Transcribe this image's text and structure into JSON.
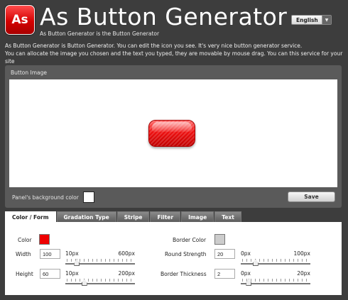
{
  "header": {
    "logo_text": "As",
    "title": "As Button Generator",
    "subtitle": "As Button Generator is the Button Generator",
    "language": {
      "selected": "English"
    }
  },
  "intro": {
    "line1": "As Button Generator is Button Generator. You can edit the icon you see. It's very nice button generator service.",
    "line2": "You can allocate the image you chosen and the text you typed, they are movable by mouse drag. You can this service for your site"
  },
  "image_panel": {
    "label": "Button Image",
    "bg_color_label": "Panel's background color",
    "bg_color": "#ffffff",
    "save_label": "Save"
  },
  "tabs": [
    {
      "label": "Color / Form",
      "active": true
    },
    {
      "label": "Gradation Type",
      "active": false
    },
    {
      "label": "Stripe",
      "active": false
    },
    {
      "label": "Filter",
      "active": false
    },
    {
      "label": "Image",
      "active": false
    },
    {
      "label": "Text",
      "active": false
    }
  ],
  "form": {
    "color": {
      "label": "Color",
      "value": "#ee0000"
    },
    "border_color": {
      "label": "Border Color",
      "value": "#cccccc"
    },
    "width": {
      "label": "Width",
      "value": "100",
      "min_label": "10px",
      "max_label": "600px",
      "min": 10,
      "max": 600
    },
    "height": {
      "label": "Height",
      "value": "60",
      "min_label": "10px",
      "max_label": "200px",
      "min": 10,
      "max": 200
    },
    "round_strength": {
      "label": "Round Strength",
      "value": "20",
      "min_label": "0px",
      "max_label": "100px",
      "min": 0,
      "max": 100
    },
    "border_thickness": {
      "label": "Border Thickness",
      "value": "2",
      "min_label": "0px",
      "max_label": "20px",
      "min": 0,
      "max": 20
    }
  }
}
